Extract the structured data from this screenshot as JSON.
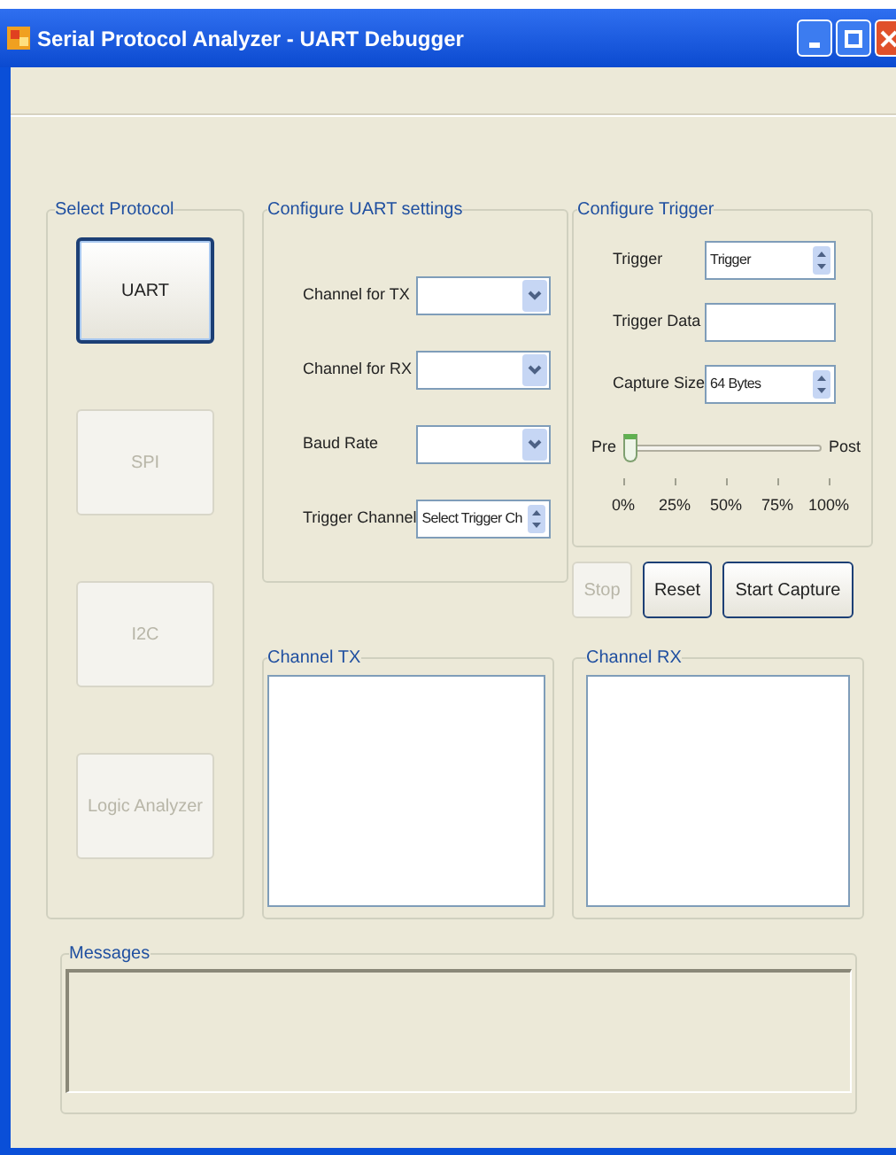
{
  "window": {
    "title": "Serial Protocol Analyzer - UART Debugger"
  },
  "protocols": {
    "title": "Select Protocol",
    "buttons": [
      {
        "label": "UART",
        "disabled": false
      },
      {
        "label": "SPI",
        "disabled": true
      },
      {
        "label": "I2C",
        "disabled": true
      },
      {
        "label": "Logic Analyzer",
        "disabled": true
      }
    ]
  },
  "uart_settings": {
    "title": "Configure UART settings",
    "fields": [
      {
        "label": "Channel for TX",
        "kind": "dropdown"
      },
      {
        "label": "Channel for RX",
        "kind": "dropdown"
      },
      {
        "label": "Baud Rate",
        "kind": "dropdown"
      },
      {
        "label": "Trigger Channel",
        "kind": "spinner",
        "value": "Select Trigger Ch"
      }
    ]
  },
  "trigger": {
    "title": "Configure Trigger",
    "fields": [
      {
        "label": "Trigger",
        "kind": "spinner",
        "value": "Trigger"
      },
      {
        "label": "Trigger Data",
        "kind": "text"
      },
      {
        "label": "Capture Size",
        "kind": "spinner",
        "value": "64 Bytes"
      }
    ],
    "slider": {
      "min_label": "Pre",
      "max_label": "Post",
      "level": 0,
      "ticks": [
        "0%",
        "25%",
        "50%",
        "75%",
        "100%"
      ]
    }
  },
  "actions": [
    {
      "label": "Stop",
      "disabled": true
    },
    {
      "label": "Reset",
      "disabled": false
    },
    {
      "label": "Start Capture",
      "disabled": false
    }
  ],
  "channel_tx": {
    "title": "Channel TX"
  },
  "channel_rx": {
    "title": "Channel RX"
  },
  "messages": {
    "title": "Messages"
  }
}
